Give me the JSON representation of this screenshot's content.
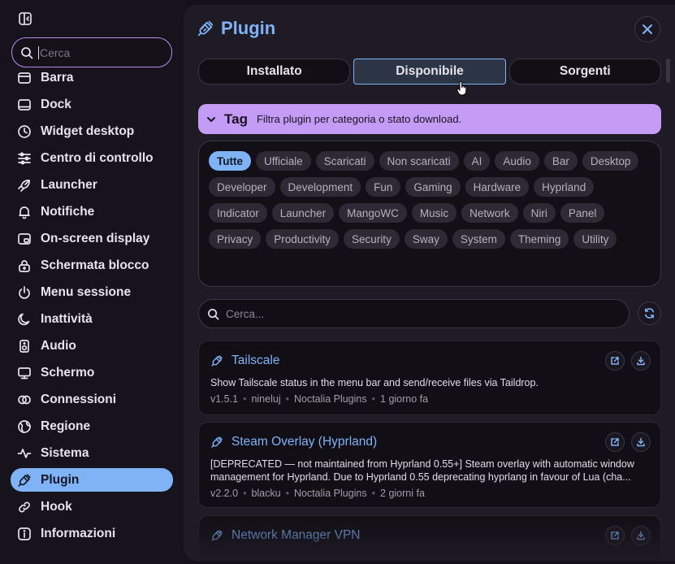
{
  "sidebar": {
    "search_placeholder": "Cerca",
    "items": [
      {
        "label": "Barra",
        "icon": "bar-icon"
      },
      {
        "label": "Dock",
        "icon": "dock-icon"
      },
      {
        "label": "Widget desktop",
        "icon": "clock-icon"
      },
      {
        "label": "Centro di controllo",
        "icon": "sliders-icon"
      },
      {
        "label": "Launcher",
        "icon": "rocket-icon"
      },
      {
        "label": "Notifiche",
        "icon": "bell-icon"
      },
      {
        "label": "On-screen display",
        "icon": "osd-icon"
      },
      {
        "label": "Schermata blocco",
        "icon": "lock-icon"
      },
      {
        "label": "Menu sessione",
        "icon": "power-icon"
      },
      {
        "label": "Inattività",
        "icon": "moon-icon"
      },
      {
        "label": "Audio",
        "icon": "speaker-icon"
      },
      {
        "label": "Schermo",
        "icon": "monitor-icon"
      },
      {
        "label": "Connessioni",
        "icon": "rings-icon"
      },
      {
        "label": "Regione",
        "icon": "globe-icon"
      },
      {
        "label": "Sistema",
        "icon": "pulse-icon"
      },
      {
        "label": "Plugin",
        "icon": "plug-icon"
      },
      {
        "label": "Hook",
        "icon": "link-icon"
      },
      {
        "label": "Informazioni",
        "icon": "info-icon"
      }
    ],
    "active_index": 15
  },
  "panel": {
    "title": "Plugin",
    "tabs": [
      "Installato",
      "Disponibile",
      "Sorgenti"
    ],
    "active_tab": 1
  },
  "tag_section": {
    "title": "Tag",
    "description": "Filtra plugin per categoria o stato download.",
    "chips": [
      "Tutte",
      "Ufficiale",
      "Scaricati",
      "Non scaricati",
      "AI",
      "Audio",
      "Bar",
      "Desktop",
      "Developer",
      "Development",
      "Fun",
      "Gaming",
      "Hardware",
      "Hyprland",
      "Indicator",
      "Launcher",
      "MangoWC",
      "Music",
      "Network",
      "Niri",
      "Panel",
      "Privacy",
      "Productivity",
      "Security",
      "Sway",
      "System",
      "Theming",
      "Utility"
    ],
    "active_chip": 0
  },
  "search": {
    "placeholder": "Cerca..."
  },
  "plugins": [
    {
      "name": "Tailscale",
      "description": "Show Tailscale status in the menu bar and send/receive files via Taildrop.",
      "version": "v1.5.1",
      "author": "nineluj",
      "source": "Noctalia Plugins",
      "updated": "1 giorno fa"
    },
    {
      "name": "Steam Overlay (Hyprland)",
      "description": "[DEPRECATED — not maintained from Hyprland 0.55+] Steam overlay with automatic window management for Hyprland. Due to Hyprland 0.55 deprecating hyprlang in favour of Lua (cha...",
      "version": "v2.2.0",
      "author": "blacku",
      "source": "Noctalia Plugins",
      "updated": "2 giorni fa"
    },
    {
      "name": "Network Manager VPN",
      "description": "",
      "version": "",
      "author": "",
      "source": "",
      "updated": ""
    }
  ]
}
